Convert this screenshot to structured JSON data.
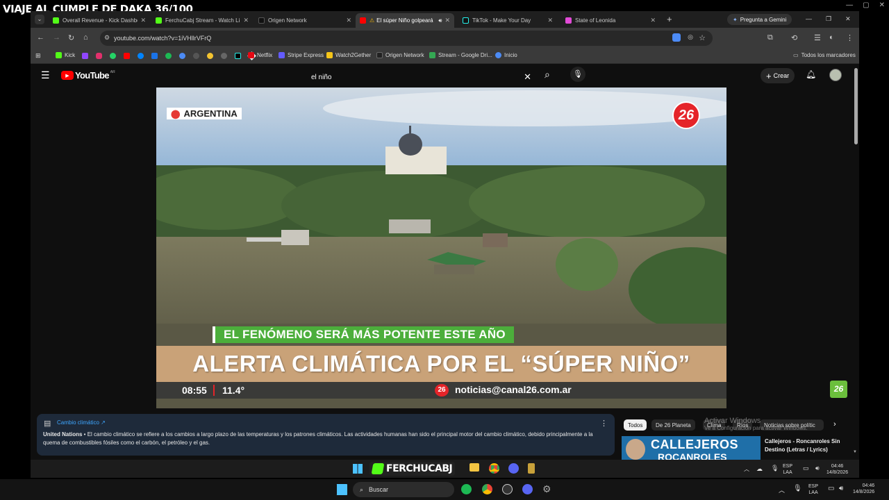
{
  "overlay": {
    "stream_title": "VIAJE AL CUMPLE DE DAKA 36/100"
  },
  "tabs": [
    {
      "title": "Overall Revenue - Kick Dashbo",
      "color": "#53fc18"
    },
    {
      "title": "FerchuCabj Stream - Watch Li",
      "color": "#53fc18"
    },
    {
      "title": "Origen Network",
      "color": "#111111"
    },
    {
      "title": "El súper Niño golpeará",
      "color": "#ff0000"
    },
    {
      "title": "TikTok - Make Your Day",
      "color": "#111111"
    },
    {
      "title": "State of Leonida",
      "color": "#e24bd7"
    }
  ],
  "gemini_button": "Pregunta a Gemini",
  "url": "youtube.com/watch?v=1iVHllrVFrQ",
  "bookmarks": [
    {
      "label": "Kick",
      "color": "#53fc18"
    },
    {
      "label": "Netflix",
      "color": "#e50914"
    },
    {
      "label": "Stripe Express",
      "color": "#635bff"
    },
    {
      "label": "Watch2Gether",
      "color": "#f5c518"
    },
    {
      "label": "Origen Network",
      "color": "#222222"
    },
    {
      "label": "Stream - Google Dri...",
      "color": "#34a853"
    },
    {
      "label": "Inicio",
      "color": "#4c8bf5"
    }
  ],
  "all_bookmarks": "Todos los marcadores",
  "youtube": {
    "logo": "YouTube",
    "country": "AR",
    "search_value": "el niño",
    "create_label": "Crear"
  },
  "video": {
    "location_tag": "ARGENTINA",
    "channel_number": "26",
    "subtitle_bar": "EL FENÓMENO SERÁ MÁS POTENTE ESTE AÑO",
    "headline": "ALERTA CLIMÁTICA POR EL “SÚPER NIÑO”",
    "time": "08:55",
    "temperature": "11.4°",
    "contact_badge": "26",
    "contact": "noticias@canal26.com.ar",
    "corner_logo": "26"
  },
  "info_panel": {
    "link": "Cambio climático ↗",
    "source": "United Nations",
    "text": " • El cambio climático se refiere a los cambios a largo plazo de las temperaturas y los patrones climáticos. Las actividades humanas han sido el principal motor del cambio climático, debido principalmente a la quema de combustibles fósiles como el carbón, el petróleo y el gas."
  },
  "chips": [
    "Todos",
    "De 26 Planeta",
    "Clima",
    "Ríos",
    "Noticias sobre polític"
  ],
  "activate_windows": {
    "line1": "Activar Windows",
    "line2": "Ve a Configuración para activar Windows."
  },
  "rec_video": {
    "thumb_text1": "CALLEJEROS",
    "thumb_text2": "ROCANROLES",
    "title": "Callejeros - Roncanroles Sin Destino (Letras / Lyrics)"
  },
  "inner_taskbar": {
    "stream_logo": "FERCHUCABJ",
    "lang": "ESP",
    "layout": "LAA",
    "time": "04:46",
    "date": "14/8/2026"
  },
  "taskbar": {
    "search": "Buscar",
    "lang": "ESP",
    "layout": "LAA",
    "time": "04:46",
    "date": "14/8/2026"
  }
}
